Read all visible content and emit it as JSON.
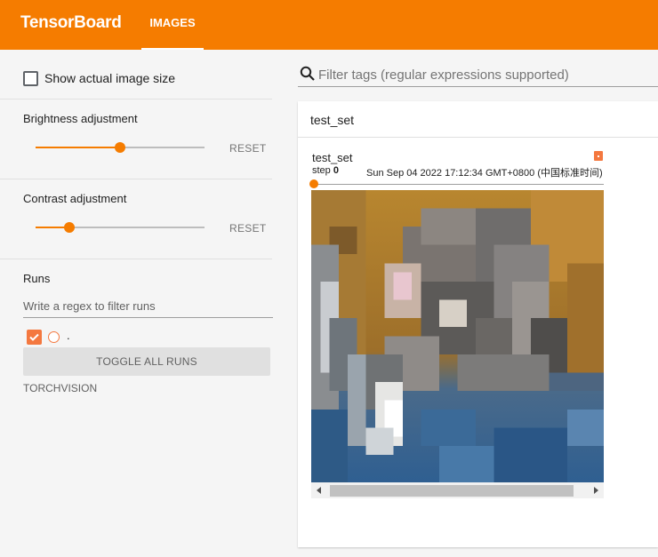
{
  "header": {
    "brand": "TensorBoard",
    "tab_label": "IMAGES",
    "accent_color": "#f57c00"
  },
  "sidebar": {
    "show_actual_size_label": "Show actual image size",
    "show_actual_size_checked": false,
    "brightness": {
      "label": "Brightness adjustment",
      "reset_label": "RESET",
      "value_fraction": 0.5
    },
    "contrast": {
      "label": "Contrast adjustment",
      "reset_label": "RESET",
      "value_fraction": 0.2
    },
    "runs": {
      "heading": "Runs",
      "filter_placeholder": "Write a regex to filter runs",
      "items": [
        {
          "name": ".",
          "checked": true,
          "color": "#f4783f"
        }
      ],
      "toggle_all_label": "TOGGLE ALL RUNS",
      "footer_label": "TORCHVISION"
    }
  },
  "main": {
    "filter_placeholder": "Filter tags (regular expressions supported)",
    "filter_icon": "search-icon",
    "panel": {
      "title": "test_set",
      "card": {
        "tag": "test_set",
        "step_label": "step",
        "step_value": "0",
        "timestamp": "Sun Sep 04 2022 17:12:34 GMT+0800 (中国标准时间)"
      }
    }
  }
}
